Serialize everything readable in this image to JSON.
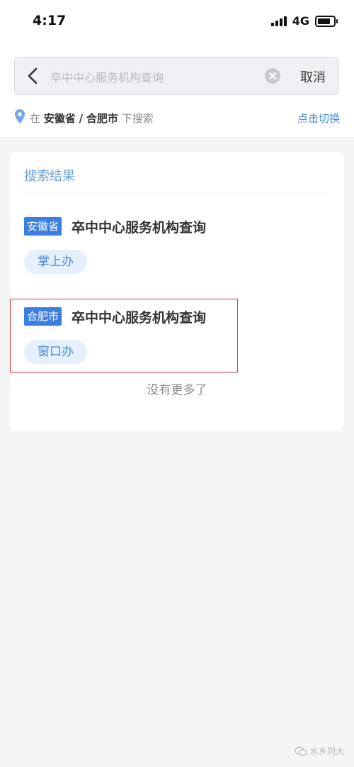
{
  "status_bar": {
    "time": "4:17",
    "network": "4G"
  },
  "search": {
    "query": "卒中中心服务机构查询",
    "cancel_label": "取消"
  },
  "location": {
    "prefix": "在",
    "province": "安徽省",
    "separator": "/",
    "city": "合肥市",
    "suffix": "下搜索",
    "switch_label": "点击切换"
  },
  "results": {
    "title": "搜索结果",
    "items": [
      {
        "region": "安徽省",
        "name": "卒中中心服务机构查询",
        "channel": "掌上办"
      },
      {
        "region": "合肥市",
        "name": "卒中中心服务机构查询",
        "channel": "窗口办"
      }
    ],
    "end_text": "没有更多了"
  },
  "watermark": "水乡同大",
  "colors": {
    "accent": "#3b7ee0",
    "link": "#3c8ae8",
    "highlight_border": "#d63a3a"
  }
}
